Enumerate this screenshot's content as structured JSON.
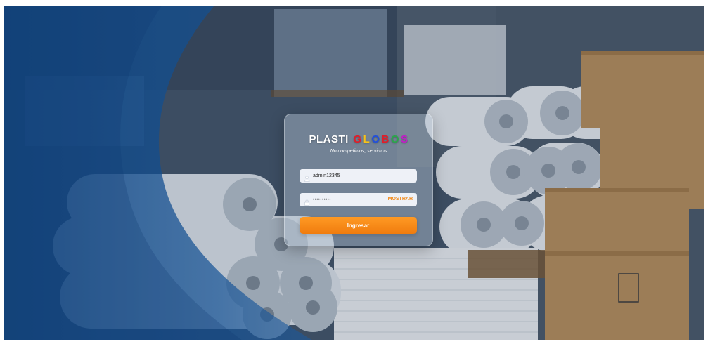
{
  "brand": {
    "prefix": "PLASTI",
    "suffix_letters": [
      "G",
      "L",
      "O",
      "B",
      "O",
      "S"
    ],
    "suffix_colors": [
      "#e11d2a",
      "#f6c21a",
      "#1f4fe0",
      "#e11d2a",
      "#2aa84a",
      "#c21dc7"
    ],
    "slogan": "No competimos, servimos"
  },
  "login": {
    "username_value": "admin12345",
    "password_mask": "••••••••••",
    "show_label": "MOSTRAR",
    "submit_label": "Ingresar"
  },
  "icons": {
    "username": "user-icon",
    "password": "lock-icon"
  },
  "colors": {
    "accent": "#f28a1a",
    "button_start": "#ff9a24",
    "button_end": "#f07c0e",
    "overlay_blue": "#0b4a8f"
  }
}
